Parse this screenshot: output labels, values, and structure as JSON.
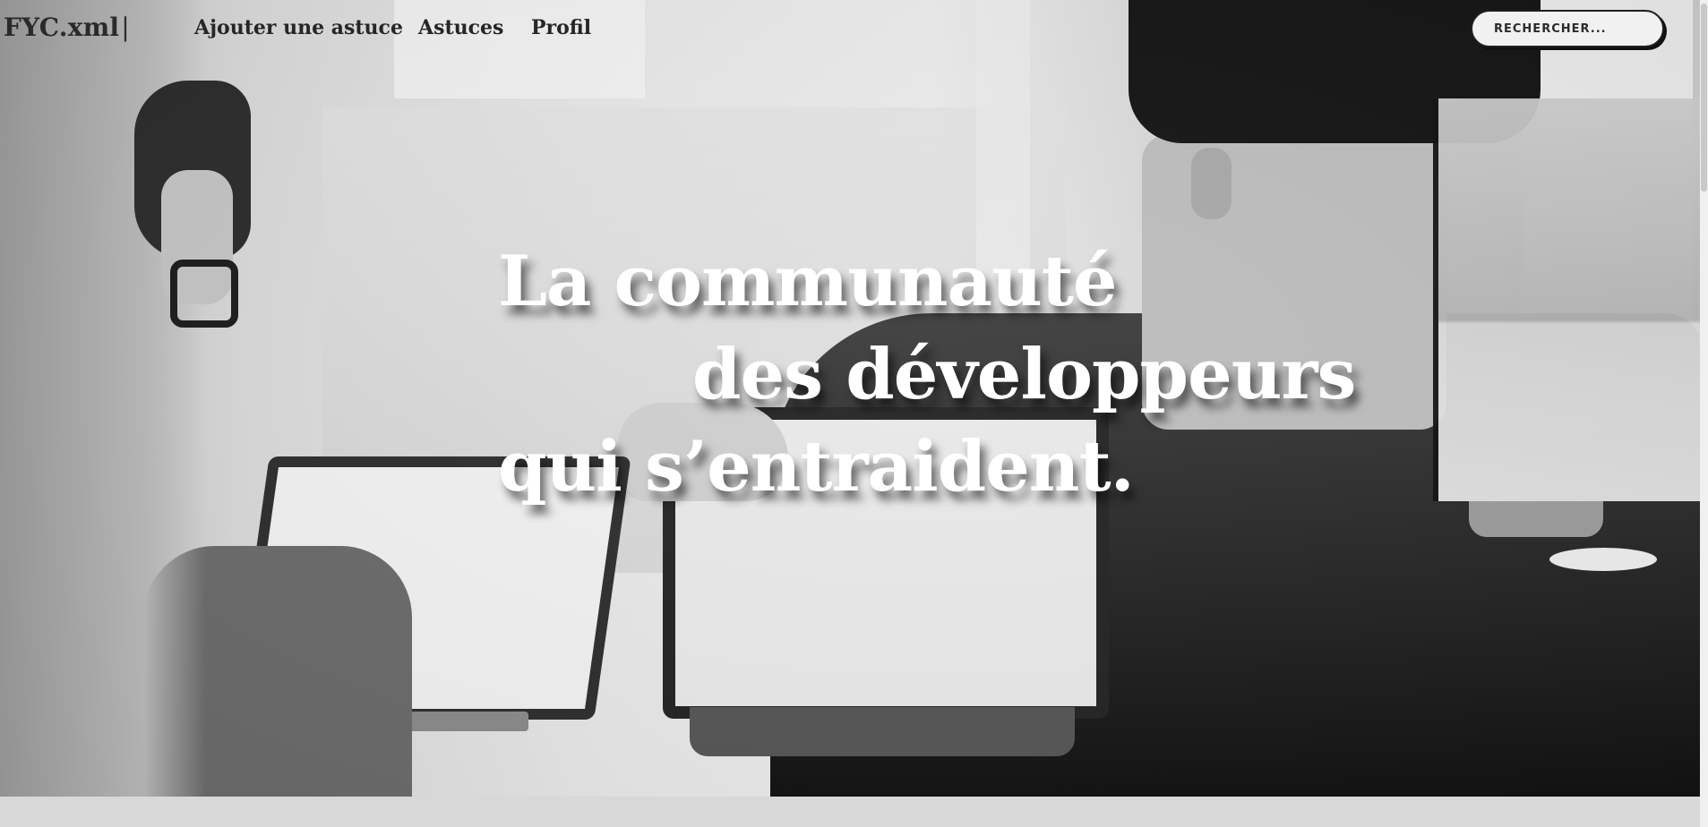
{
  "header": {
    "brand": "FYC.xml",
    "brand_caret": "|",
    "nav": {
      "add_tip": "Ajouter une astuce",
      "tips": "Astuces",
      "profile": "Profil"
    },
    "search": {
      "placeholder": "RECHERCHER..."
    }
  },
  "hero": {
    "image_description": "grayscale-office-photo",
    "headline": {
      "line1": "La communauté",
      "line2": "des développeurs",
      "line3": "qui s’entraident."
    }
  },
  "colors": {
    "headline": "#ffffff",
    "nav_text": "#262626",
    "bottom_bar": "#d8d8d8"
  }
}
